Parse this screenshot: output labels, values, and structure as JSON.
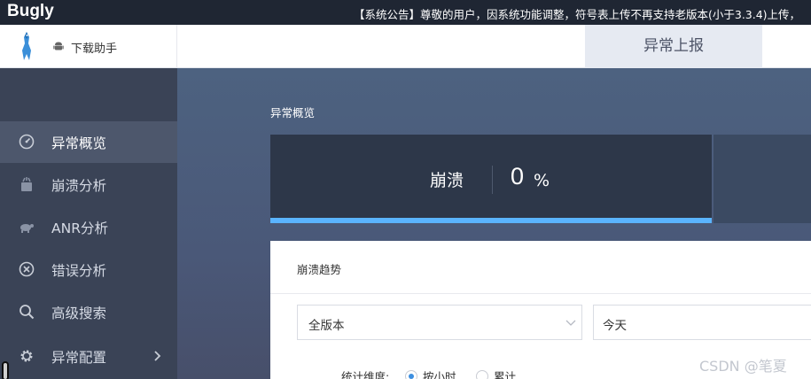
{
  "topbar": {
    "brand": "Bugly",
    "notice": "【系统公告】尊敬的用户，因系统功能调整，符号表上传不再支持老版本(小于3.3.4)上传，"
  },
  "header": {
    "download_label": "下载助手",
    "report_tab": "异常上报"
  },
  "sidebar": {
    "items": [
      {
        "label": "异常概览",
        "icon": "dashboard-icon",
        "active": true
      },
      {
        "label": "崩溃分析",
        "icon": "crash-icon"
      },
      {
        "label": "ANR分析",
        "icon": "turtle-icon"
      },
      {
        "label": "错误分析",
        "icon": "error-circle-icon"
      },
      {
        "label": "高级搜索",
        "icon": "search-icon"
      },
      {
        "label": "异常配置",
        "icon": "gear-icon"
      }
    ]
  },
  "main": {
    "section_title": "异常概览",
    "crash_card": {
      "label": "崩溃",
      "value": "0",
      "unit": "%",
      "bar_color": "#5ab4ff"
    },
    "panel": {
      "title": "崩溃趋势",
      "version_select": {
        "value": "全版本"
      },
      "date_select": {
        "value": "今天"
      },
      "stat_dimension_label": "统计维度:",
      "options": [
        {
          "label": "按小时",
          "checked": true
        },
        {
          "label": "累计",
          "checked": false
        }
      ]
    }
  },
  "watermark": "CSDN @笔夏",
  "colors": {
    "topbar": "#1f2633",
    "sidebar": "#3a4356",
    "accent": "#5ab4ff"
  }
}
